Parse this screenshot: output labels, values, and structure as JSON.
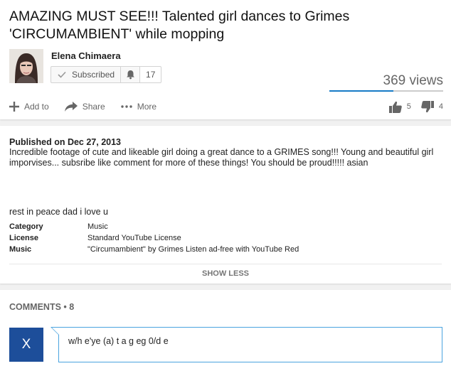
{
  "video": {
    "title": "AMAZING MUST SEE!!! Talented girl dances to Grimes 'CIRCUMAMBIENT' while mopping",
    "views": "369 views",
    "like_ratio": 0.56
  },
  "channel": {
    "name": "Elena Chimaera",
    "subscribe_label": "Subscribed",
    "subscriber_count": "17"
  },
  "actions": {
    "add_to": "Add to",
    "share": "Share",
    "more": "More",
    "likes": "5",
    "dislikes": "4"
  },
  "description": {
    "published": "Published on Dec 27, 2013",
    "text": "Incredible footage of cute and likeable girl doing a great dance to a GRIMES song!!! Young and beautiful girl imporvises... subsribe like comment for more of these things! You should be proud!!!!! asian",
    "extra": "rest in peace dad i love u",
    "meta": [
      {
        "label": "Category",
        "value": "Music"
      },
      {
        "label": "License",
        "value": "Standard YouTube License"
      },
      {
        "label": "Music",
        "value": "\"Circumambient\" by Grimes Listen ad-free with YouTube Red"
      }
    ],
    "show_less": "SHOW LESS"
  },
  "comments": {
    "header": "COMMENTS • 8",
    "user_initial": "X",
    "draft": "w/h e'ye (a) t a g eg 0/d e"
  },
  "colors": {
    "accent": "#167ac6",
    "avatar_bg": "#1d4e9a",
    "focus_border": "#4aa3df"
  },
  "icons": [
    "check-icon",
    "bell-icon",
    "plus-icon",
    "share-arrow-icon",
    "more-dots-icon",
    "thumbs-up-icon",
    "thumbs-down-icon"
  ]
}
